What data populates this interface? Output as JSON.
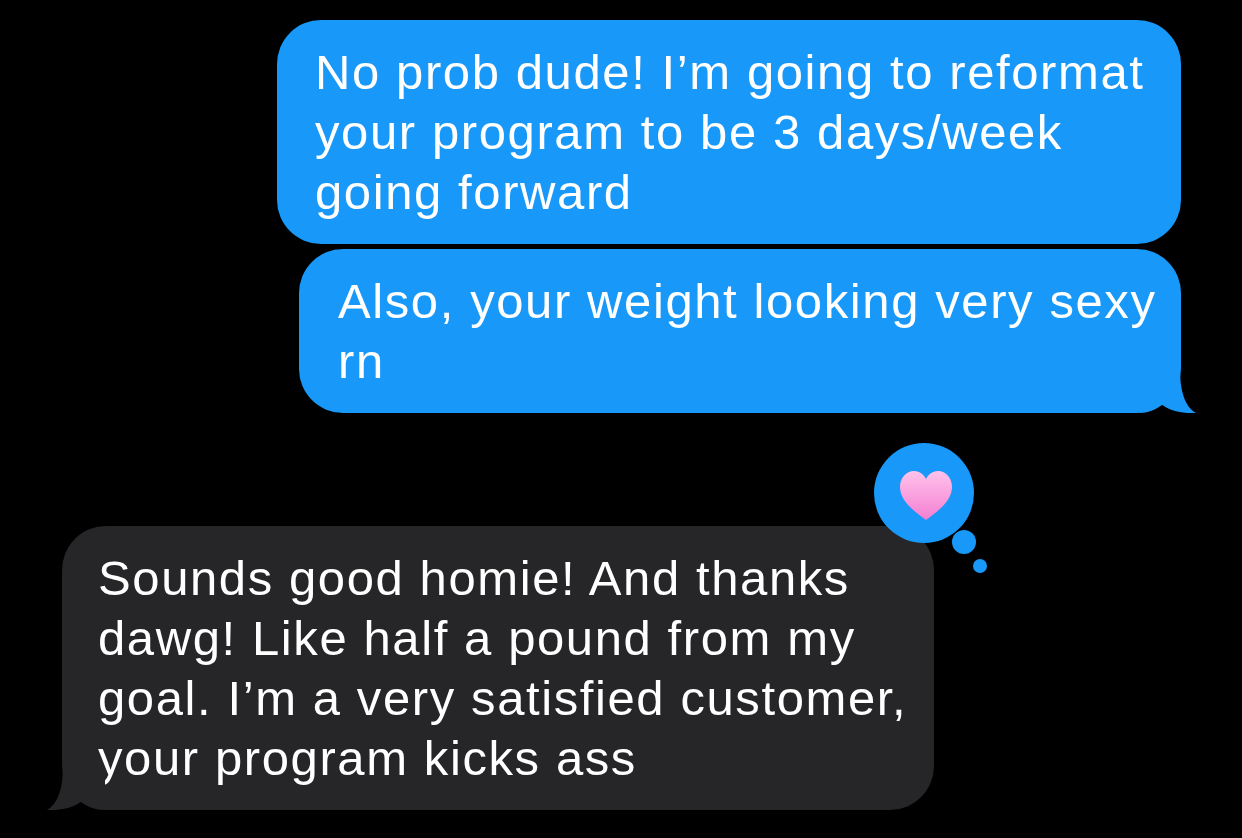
{
  "messages": [
    {
      "kind": "sent",
      "text": "No prob dude! I’m going to reformat your program to be 3 days/week going forward",
      "tail": false
    },
    {
      "kind": "sent",
      "text": "Also, your weight looking very sexy rn",
      "tail": true
    },
    {
      "kind": "received",
      "text": "Sounds good homie! And thanks dawg! Like half a pound from my goal. I’m a very satisfied customer, your program kicks ass",
      "tail": true,
      "hearted": true
    }
  ]
}
